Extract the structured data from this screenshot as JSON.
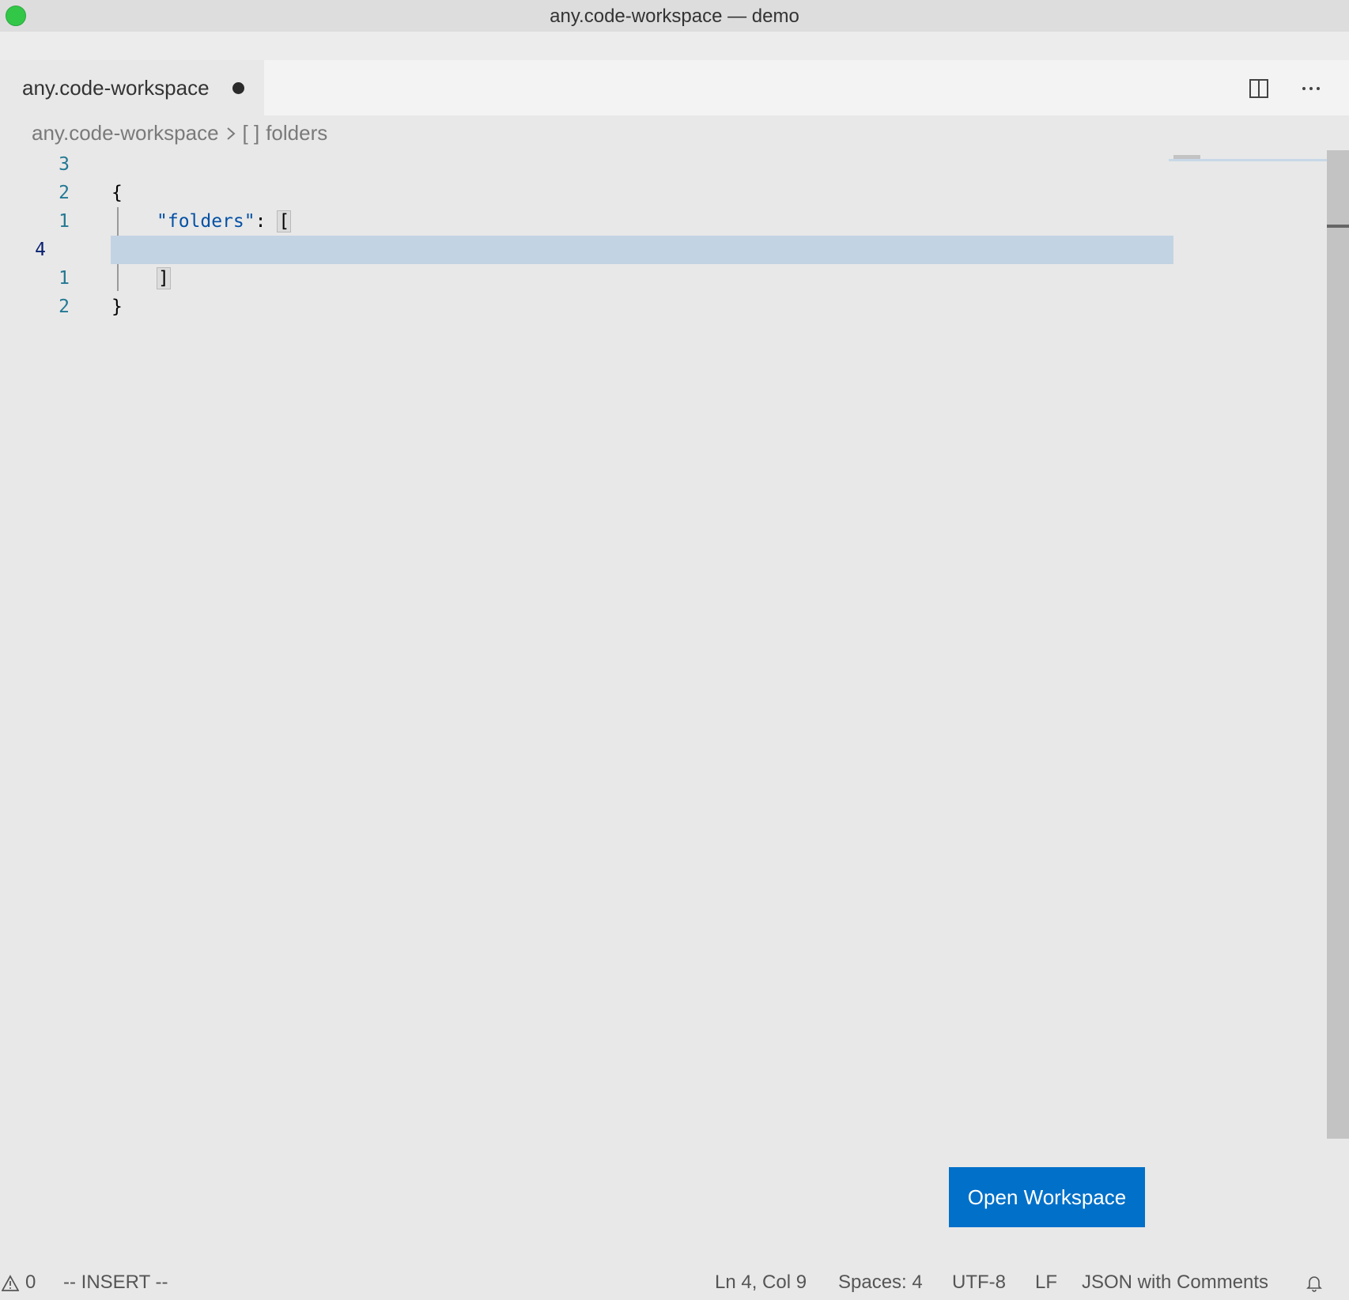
{
  "window": {
    "title": "any.code-workspace — demo"
  },
  "tab": {
    "label": "any.code-workspace"
  },
  "breadcrumb": {
    "file": "any.code-workspace",
    "symbol_icon": "[ ]",
    "symbol": "folders"
  },
  "editor": {
    "lines": [
      {
        "number": "3",
        "text": ""
      },
      {
        "number": "2",
        "text": "{"
      },
      {
        "number": "1",
        "key": "\"folders\"",
        "sep": ": ",
        "bracket": "["
      },
      {
        "number": "4",
        "text": ""
      },
      {
        "number": "1",
        "bracket": "]"
      },
      {
        "number": "2",
        "text": "}"
      }
    ]
  },
  "button": {
    "open_workspace": "Open Workspace"
  },
  "status": {
    "problems": "0",
    "mode": "-- INSERT --",
    "position": "Ln 4, Col 9",
    "spaces": "Spaces: 4",
    "encoding": "UTF-8",
    "eol": "LF",
    "language": "JSON with Comments"
  },
  "colors": {
    "accent": "#0070c9",
    "line_number": "#237893",
    "json_key": "#0451a5",
    "current_line": "#c2d3e3"
  },
  "icons": [
    "split-editor-icon",
    "more-actions-icon",
    "chevron-right-icon",
    "warning-icon",
    "bell-icon"
  ]
}
